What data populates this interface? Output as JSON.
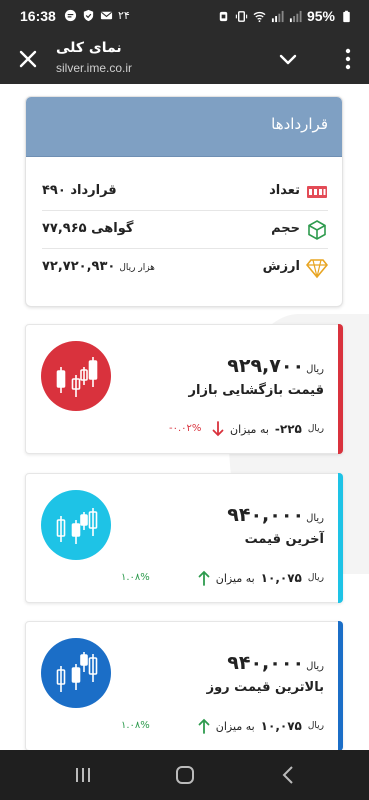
{
  "status_bar": {
    "time": "16:38",
    "notif_count": "۲۴",
    "battery": "95%"
  },
  "header": {
    "title": "نمای کلی",
    "url": "silver.ime.co.ir"
  },
  "contracts": {
    "title": "قراردادها",
    "rows": [
      {
        "label": "تعداد",
        "value": "۴۹۰ قرارداد",
        "unit": "",
        "icon": "contracts-count-icon"
      },
      {
        "label": "حجم",
        "value": "۷۷,۹۶۵ گواهی",
        "unit": "",
        "icon": "volume-cube-icon"
      },
      {
        "label": "ارزش",
        "value": "۷۲,۷۲۰,۹۳۰",
        "unit": "هزار ریال",
        "icon": "diamond-icon"
      }
    ]
  },
  "price_cards": [
    {
      "name": "قیمت بازگشایی بازار",
      "price": "۹۲۹,۷۰۰",
      "unit": "ریال",
      "change_label": "به میزان",
      "change_amount": "-۲۲۵",
      "change_unit": "ریال",
      "change_percent": "-۰.۰۲%",
      "direction": "down",
      "color": "#d9323d",
      "percent_color": "#d9323d"
    },
    {
      "name": "آخرین قیمت",
      "price": "۹۴۰,۰۰۰",
      "unit": "ریال",
      "change_label": "به میزان",
      "change_amount": "۱۰,۰۷۵",
      "change_unit": "ریال",
      "change_percent": "۱.۰۸%",
      "direction": "up",
      "color": "#1ec3e6",
      "percent_color": "#2e9b4e"
    },
    {
      "name": "بالاترین قیمت روز",
      "price": "۹۴۰,۰۰۰",
      "unit": "ریال",
      "change_label": "به میزان",
      "change_amount": "۱۰,۰۷۵",
      "change_unit": "ریال",
      "change_percent": "۱.۰۸%",
      "direction": "up",
      "color": "#1b6ec7",
      "percent_color": "#2e9b4e"
    }
  ]
}
